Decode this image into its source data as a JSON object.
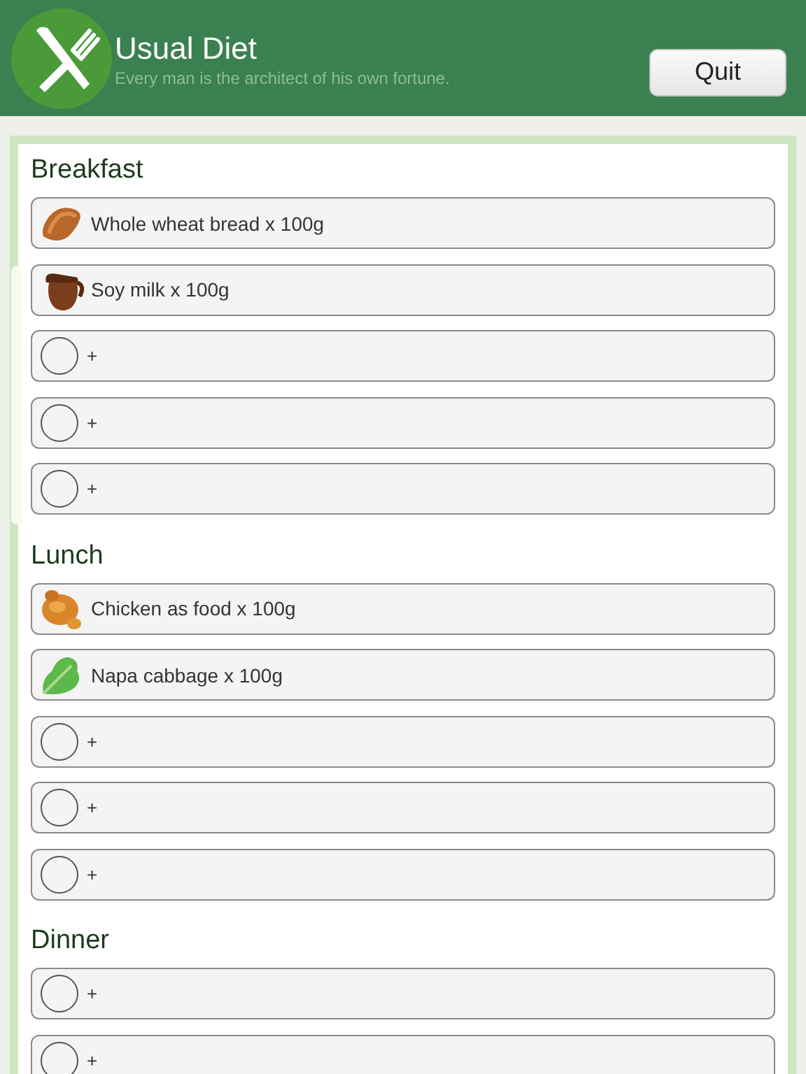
{
  "header": {
    "title": "Usual Diet",
    "subtitle": "Every man is the architect of his own fortune.",
    "button": "Quit"
  },
  "meals": [
    {
      "title": "Breakfast",
      "items": [
        {
          "kind": "bread",
          "label": "Whole wheat bread x 100g"
        },
        {
          "kind": "jug",
          "label": "Soy milk x 100g"
        },
        {
          "kind": "empty",
          "label": "+"
        },
        {
          "kind": "empty",
          "label": "+"
        },
        {
          "kind": "empty",
          "label": "+"
        }
      ]
    },
    {
      "title": "Lunch",
      "items": [
        {
          "kind": "chicken",
          "label": "Chicken as food x 100g"
        },
        {
          "kind": "cabbage",
          "label": "Napa cabbage x 100g"
        },
        {
          "kind": "empty",
          "label": "+"
        },
        {
          "kind": "empty",
          "label": "+"
        },
        {
          "kind": "empty",
          "label": "+"
        }
      ]
    },
    {
      "title": "Dinner",
      "items": [
        {
          "kind": "empty",
          "label": "+"
        },
        {
          "kind": "empty",
          "label": "+"
        }
      ]
    }
  ]
}
